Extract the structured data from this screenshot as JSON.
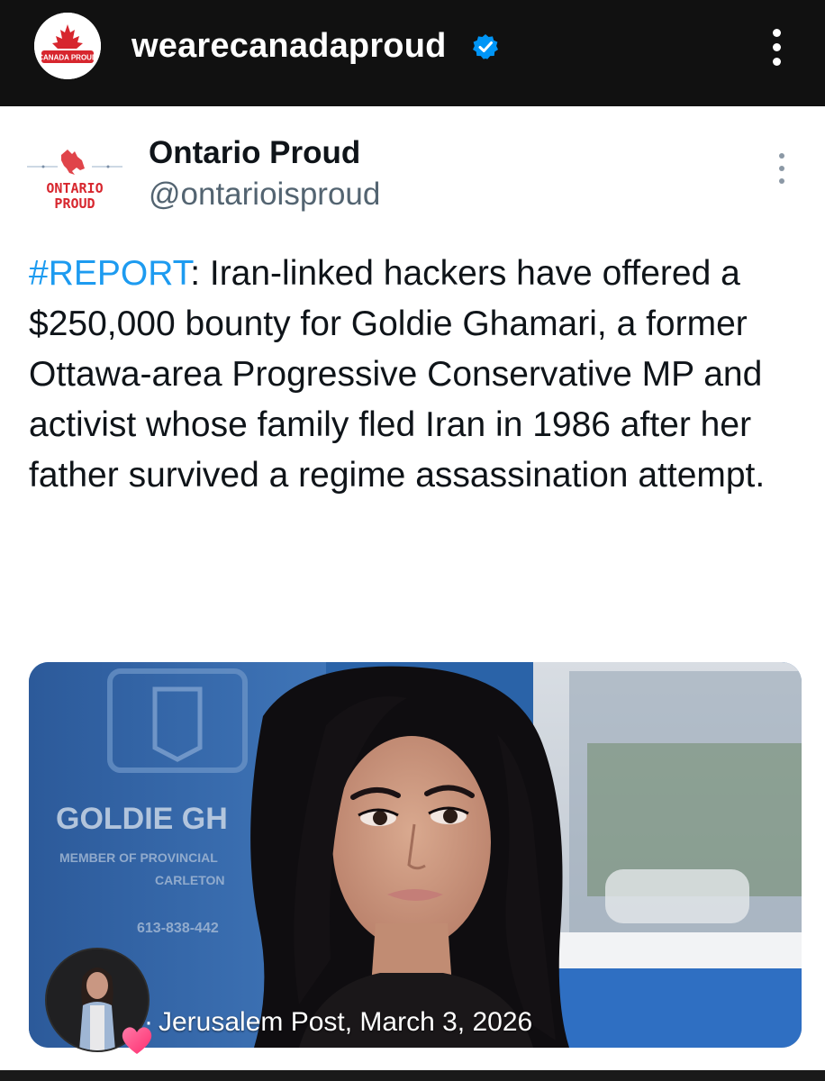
{
  "account": {
    "username": "wearecanadaproud",
    "avatar_text": "CANADA PROUD",
    "verified_icon": "verified-badge-icon",
    "more_icon": "more-vertical-icon"
  },
  "tweet": {
    "author_name": "Ontario Proud",
    "author_handle": "@ontarioisproud",
    "logo_text_line1": "ONTARIO",
    "logo_text_line2": "PROUD",
    "hashtag": "#REPORT",
    "body": ": Iran-linked hackers have offered a $250,000 bounty for Goldie Ghamari, a former Ottawa-area Progressive Conservative MP and activist whose family fled Iran in 1986 after her father survived a regime assassination attempt.",
    "media_caption": "Jerusalem Post, March 3, 2026",
    "sign_text_1": "GOLDIE GH",
    "sign_text_2": "MEMBER OF PROVINCIAL",
    "sign_text_3": "CARLETON",
    "sign_text_4": "613-838-442"
  },
  "colors": {
    "topbar": "#111111",
    "hashtag": "#1d9bf0",
    "handle": "#536471",
    "verified": "#0095f6",
    "brand_red": "#d7262e"
  }
}
